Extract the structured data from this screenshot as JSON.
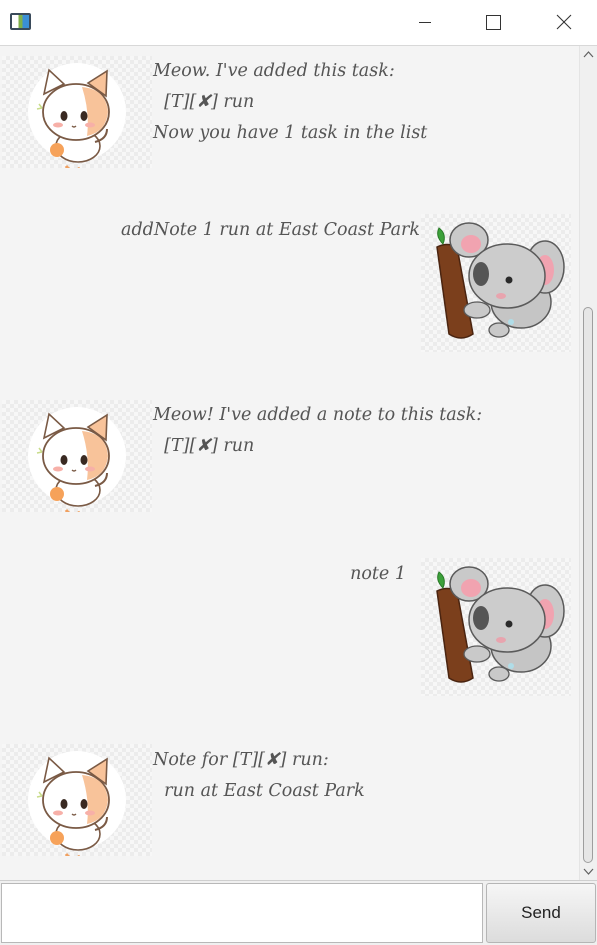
{
  "window": {
    "icon": "app-icon",
    "controls": [
      "minimize-icon",
      "maximize-icon",
      "close-icon"
    ]
  },
  "messages": [
    {
      "sender": "bot",
      "avatar": "cat-avatar",
      "text": "Meow. I've added this task:\n  [T][✘] run\nNow you have 1 task in the list"
    },
    {
      "sender": "user",
      "avatar": "koala-avatar",
      "text": "addNote 1 run at East Coast Park"
    },
    {
      "sender": "bot",
      "avatar": "cat-avatar",
      "text": "Meow! I've added a note to this task:\n  [T][✘] run"
    },
    {
      "sender": "user",
      "avatar": "koala-avatar",
      "text": "note 1"
    },
    {
      "sender": "bot",
      "avatar": "cat-avatar",
      "text": "Note for [T][✘] run:\n  run at East Coast Park"
    }
  ],
  "input": {
    "value": "",
    "placeholder": ""
  },
  "send_label": "Send",
  "colors": {
    "chat_background": "#f4f4f4",
    "message_text": "#555555"
  }
}
